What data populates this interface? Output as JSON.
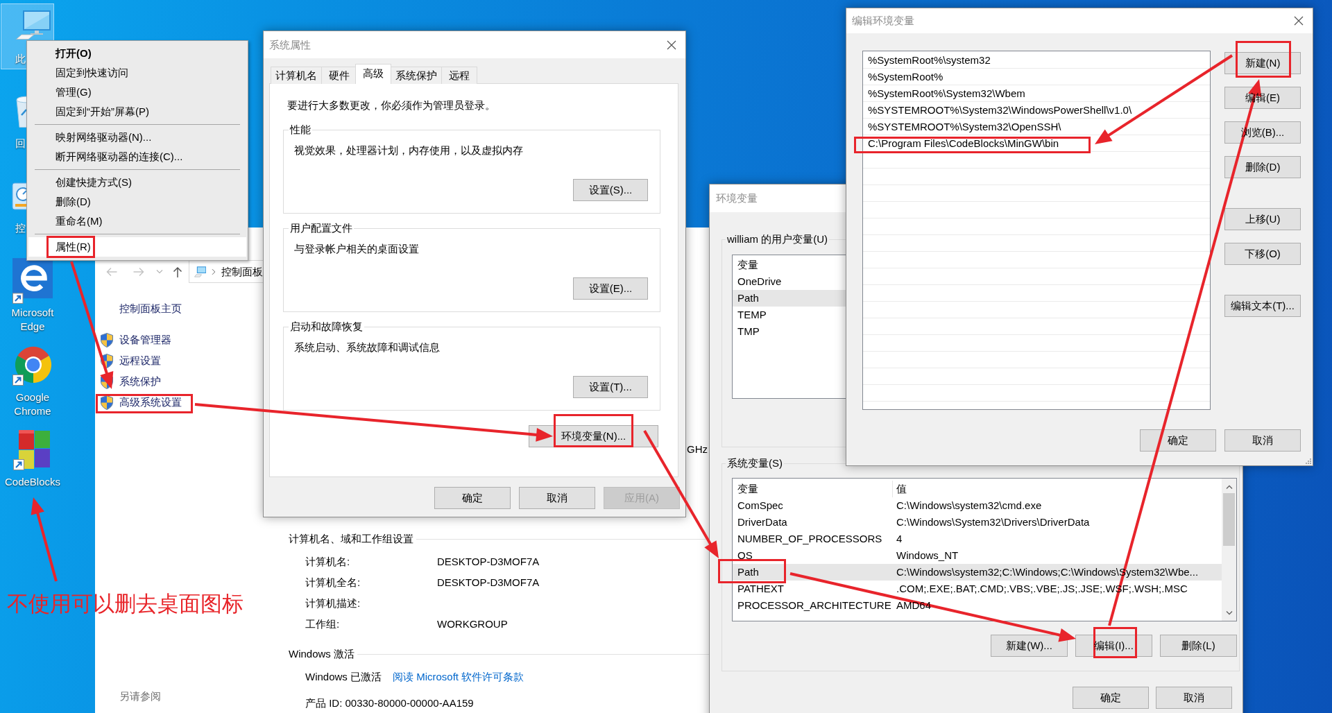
{
  "desktop": {
    "icons": [
      {
        "kind": "computer",
        "label": "此",
        "selected": true
      },
      {
        "kind": "recycle_bin",
        "label": "回",
        "selected": false
      },
      {
        "kind": "control_panel",
        "label": "控",
        "selected": false
      },
      {
        "kind": "edge",
        "label": "Microsoft Edge",
        "selected": false
      },
      {
        "kind": "chrome",
        "label": "Google Chrome",
        "selected": false
      },
      {
        "kind": "codeblocks",
        "label": "CodeBlocks",
        "selected": false
      }
    ],
    "note": "不使用可以删去桌面图标"
  },
  "context_menu": {
    "groups": [
      [
        {
          "label": "打开(O)",
          "default": true,
          "selected": false
        },
        {
          "label": "固定到快速访问",
          "default": false,
          "selected": false
        },
        {
          "label": "管理(G)",
          "default": false,
          "selected": false
        },
        {
          "label": "固定到“开始”屏幕(P)",
          "default": false,
          "selected": false
        }
      ],
      [
        {
          "label": "映射网络驱动器(N)...",
          "default": false,
          "selected": false
        },
        {
          "label": "断开网络驱动器的连接(C)...",
          "default": false,
          "selected": false
        }
      ],
      [
        {
          "label": "创建快捷方式(S)",
          "default": false,
          "selected": false
        },
        {
          "label": "删除(D)",
          "default": false,
          "selected": false
        },
        {
          "label": "重命名(M)",
          "default": false,
          "selected": false
        }
      ],
      [
        {
          "label": "属性(R)",
          "default": false,
          "selected": true
        }
      ]
    ]
  },
  "control_panel": {
    "address": "控制面板",
    "home_link": "控制面板主页",
    "tasks": [
      "设备管理器",
      "远程设置",
      "系统保护",
      "高级系统设置"
    ],
    "processor_fragment": "GHz",
    "sections": [
      {
        "title": "计算机名、域和工作组设置",
        "rows": [
          {
            "kind": "pair",
            "label": "计算机名:",
            "value": "DESKTOP-D3MOF7A"
          },
          {
            "kind": "pair",
            "label": "计算机全名:",
            "value": "DESKTOP-D3MOF7A"
          },
          {
            "kind": "pair",
            "label": "计算机描述:"
          },
          {
            "kind": "pair",
            "label": "工作组:",
            "value": "WORKGROUP"
          }
        ]
      },
      {
        "title": "Windows 激活",
        "rows": [
          {
            "kind": "status",
            "label": "Windows 已激活",
            "link": "阅读 Microsoft 软件许可条款"
          },
          {
            "kind": "text",
            "label": "产品 ID: 00330-80000-00000-AA159"
          }
        ]
      }
    ],
    "see_also": "另请参阅"
  },
  "system_properties": {
    "title": "系统属性",
    "tabs": [
      {
        "label": "计算机名",
        "selected": false
      },
      {
        "label": "硬件",
        "selected": false
      },
      {
        "label": "高级",
        "selected": true
      },
      {
        "label": "系统保护",
        "selected": false
      },
      {
        "label": "远程",
        "selected": false
      }
    ],
    "notice": "要进行大多数更改，你必须作为管理员登录。",
    "groups": [
      {
        "title": "性能",
        "text": "视觉效果，处理器计划，内存使用，以及虚拟内存",
        "button": "设置(S)..."
      },
      {
        "title": "用户配置文件",
        "text": "与登录帐户相关的桌面设置",
        "button": "设置(E)..."
      },
      {
        "title": "启动和故障恢复",
        "text": "系统启动、系统故障和调试信息",
        "button": "设置(T)..."
      }
    ],
    "env_button": "环境变量(N)...",
    "buttons": [
      {
        "label": "确定",
        "disabled": false
      },
      {
        "label": "取消",
        "disabled": false
      },
      {
        "label": "应用(A)",
        "disabled": true
      }
    ]
  },
  "environment_variables": {
    "title": "环境变量",
    "user_variables": {
      "title": "william 的用户变量(U)",
      "column": "变量",
      "rows": [
        {
          "name": "OneDrive",
          "selected": false
        },
        {
          "name": "Path",
          "selected": true
        },
        {
          "name": "TEMP",
          "selected": false
        },
        {
          "name": "TMP",
          "selected": false
        }
      ]
    },
    "system_variables": {
      "title": "系统变量(S)",
      "columns": [
        "变量",
        "值"
      ],
      "rows": [
        {
          "name": "ComSpec",
          "value": "C:\\Windows\\system32\\cmd.exe",
          "selected": false
        },
        {
          "name": "DriverData",
          "value": "C:\\Windows\\System32\\Drivers\\DriverData",
          "selected": false
        },
        {
          "name": "NUMBER_OF_PROCESSORS",
          "value": "4",
          "selected": false
        },
        {
          "name": "OS",
          "value": "Windows_NT",
          "selected": false
        },
        {
          "name": "Path",
          "value": "C:\\Windows\\system32;C:\\Windows;C:\\Windows\\System32\\Wbe...",
          "selected": true
        },
        {
          "name": "PATHEXT",
          "value": ".COM;.EXE;.BAT;.CMD;.VBS;.VBE;.JS;.JSE;.WSF;.WSH;.MSC",
          "selected": false
        },
        {
          "name": "PROCESSOR_ARCHITECTURE",
          "value": "AMD64",
          "selected": false
        }
      ],
      "buttons": [
        "新建(W)...",
        "编辑(I)...",
        "删除(L)"
      ]
    },
    "buttons": [
      "确定",
      "取消"
    ]
  },
  "edit_environment_variable": {
    "title": "编辑环境变量",
    "entries": [
      {
        "text": "%SystemRoot%\\system32",
        "selected": false
      },
      {
        "text": "%SystemRoot%",
        "selected": false
      },
      {
        "text": "%SystemRoot%\\System32\\Wbem",
        "selected": false
      },
      {
        "text": "%SYSTEMROOT%\\System32\\WindowsPowerShell\\v1.0\\",
        "selected": false
      },
      {
        "text": "%SYSTEMROOT%\\System32\\OpenSSH\\",
        "selected": false
      },
      {
        "text": "C:\\Program Files\\CodeBlocks\\MinGW\\bin",
        "selected": false
      }
    ],
    "side_buttons": [
      [
        "新建(N)",
        "编辑(E)",
        "浏览(B)...",
        "删除(D)"
      ],
      [
        "上移(U)",
        "下移(O)"
      ],
      [
        "编辑文本(T)..."
      ]
    ],
    "buttons": [
      "确定",
      "取消"
    ]
  }
}
